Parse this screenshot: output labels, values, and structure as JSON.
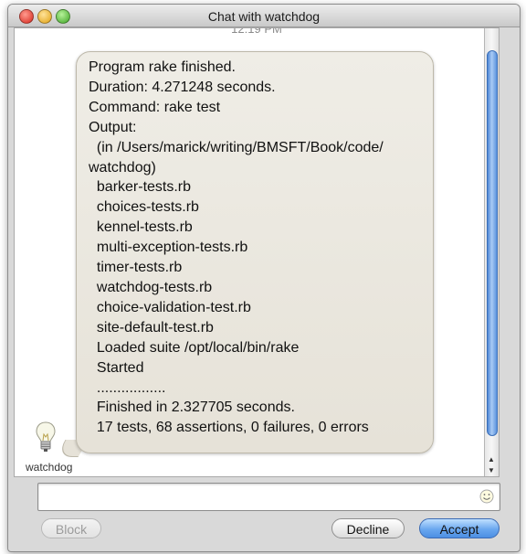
{
  "window": {
    "title": "Chat with watchdog"
  },
  "chat": {
    "timestamp": "12:19 PM",
    "sender": "watchdog",
    "message_lines": [
      "Program rake finished.",
      "Duration: 4.271248 seconds.",
      "Command: rake test",
      "Output:",
      "  (in /Users/marick/writing/BMSFT/Book/code/",
      "watchdog)",
      "  barker-tests.rb",
      "  choices-tests.rb",
      "  kennel-tests.rb",
      "  multi-exception-tests.rb",
      "  timer-tests.rb",
      "  watchdog-tests.rb",
      "  choice-validation-test.rb",
      "  site-default-test.rb",
      "  Loaded suite /opt/local/bin/rake",
      "  Started",
      "  .................",
      "  Finished in 2.327705 seconds.",
      "",
      "  17 tests, 68 assertions, 0 failures, 0 errors"
    ],
    "icons": {
      "sender_avatar": "lightbulb-icon",
      "emoticon": "smiley-icon"
    }
  },
  "input": {
    "value": "",
    "placeholder": ""
  },
  "buttons": {
    "block": "Block",
    "decline": "Decline",
    "accept": "Accept"
  },
  "colors": {
    "accept_button": "#6aa7ef",
    "bubble": "#e6e2d8",
    "scroll_thumb": "#5b93de"
  }
}
